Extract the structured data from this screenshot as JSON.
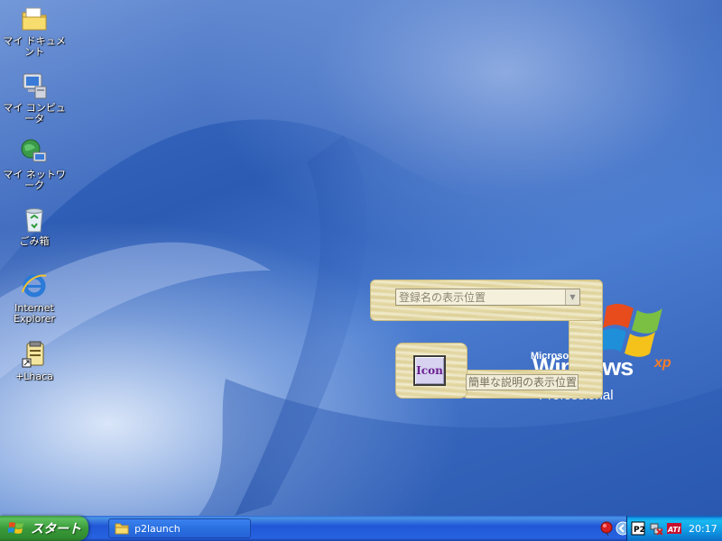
{
  "desktop": {
    "icons": [
      {
        "label": "マイ ドキュメント",
        "icon": "my-documents-folder-icon"
      },
      {
        "label": "マイ コンピュータ",
        "icon": "my-computer-icon"
      },
      {
        "label": "マイ ネットワーク",
        "icon": "my-network-icon"
      },
      {
        "label": "ごみ箱",
        "icon": "recycle-bin-icon"
      },
      {
        "label": "Internet Explorer",
        "icon": "internet-explorer-icon"
      },
      {
        "label": "+Lhaca",
        "icon": "lhaca-shortcut-icon"
      }
    ],
    "wallpaper_logo": {
      "maker": "Microsoft",
      "product": "Windows",
      "version": "xp",
      "edition": "Professional"
    }
  },
  "p2launch": {
    "combo_placeholder": "登録名の表示位置",
    "icon_button_label": "Icon",
    "description_placeholder": "簡単な説明の表示位置"
  },
  "taskbar": {
    "start_label": "スタート",
    "tasks": [
      {
        "label": "p2launch",
        "icon": "folder-icon"
      }
    ],
    "tray": {
      "clock": "20:17",
      "icons": [
        "red-balloon-icon",
        "chevron-left-icon",
        "p2-tray-icon",
        "network-disconnected-icon",
        "ati-icon"
      ]
    }
  },
  "colors": {
    "taskbar_blue": "#2157d7",
    "start_green": "#3a9a3a",
    "tray_blue": "#0f8ede",
    "wood": "#e9dfae"
  }
}
